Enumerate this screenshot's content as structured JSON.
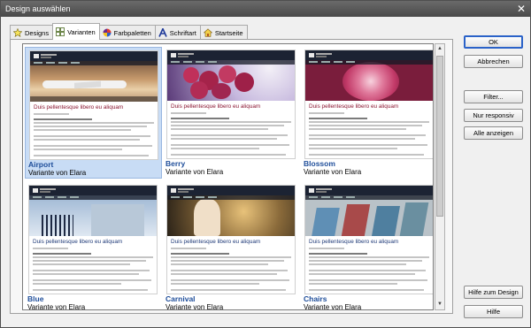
{
  "window": {
    "title": "Design auswählen",
    "close_glyph": "✕"
  },
  "tabs": [
    {
      "label": "Designs",
      "icon": "star-icon",
      "active": false
    },
    {
      "label": "Varianten",
      "icon": "grid-icon",
      "active": true
    },
    {
      "label": "Farbpaletten",
      "icon": "color-palette-icon",
      "active": false
    },
    {
      "label": "Schriftart",
      "icon": "font-icon",
      "active": false
    },
    {
      "label": "Startseite",
      "icon": "home-icon",
      "active": false
    }
  ],
  "gallery": {
    "items": [
      {
        "name": "Airport",
        "subtitle": "Variante von Elara",
        "preview_heading": "Duis pellentesque libero eu aliquam",
        "selected": true,
        "heading_color": "#8a1530",
        "image": "airport"
      },
      {
        "name": "Berry",
        "subtitle": "Variante von Elara",
        "preview_heading": "Duis pellentesque libero eu aliquam",
        "selected": false,
        "heading_color": "#8a1530",
        "image": "berry"
      },
      {
        "name": "Blossom",
        "subtitle": "Variante von Elara",
        "preview_heading": "Duis pellentesque libero eu aliquam",
        "selected": false,
        "heading_color": "#8a1530",
        "image": "blossom"
      },
      {
        "name": "Blue",
        "subtitle": "Variante von Elara",
        "preview_heading": "Duis pellentesque libero eu aliquam",
        "selected": false,
        "heading_color": "#1f3a78",
        "image": "blue"
      },
      {
        "name": "Carnival",
        "subtitle": "Variante von Elara",
        "preview_heading": "Duis pellentesque libero eu aliquam",
        "selected": false,
        "heading_color": "#1f3a78",
        "image": "carnival"
      },
      {
        "name": "Chairs",
        "subtitle": "Variante von Elara",
        "preview_heading": "Duis pellentesque libero eu aliquam",
        "selected": false,
        "heading_color": "#1f3a78",
        "image": "chairs"
      }
    ]
  },
  "buttons": {
    "ok": "OK",
    "cancel": "Abbrechen",
    "filter": "Filter...",
    "responsive": "Nur responsiv",
    "show_all": "Alle anzeigen",
    "design_help": "Hilfe zum Design",
    "help": "Hilfe"
  },
  "scrollbar": {
    "up_glyph": "▲",
    "down_glyph": "▼"
  }
}
